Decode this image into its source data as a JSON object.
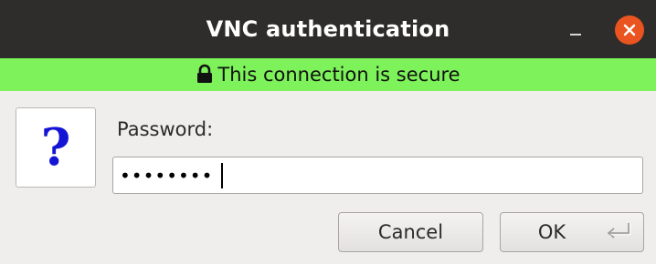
{
  "window": {
    "title": "VNC authentication",
    "controls": {
      "minimize_icon": "minimize-icon",
      "close_icon": "close-icon"
    },
    "colors": {
      "titlebar": "#2e2d2b",
      "close": "#e95420",
      "secure_bar": "#7df25a"
    }
  },
  "security": {
    "text": "This connection is secure",
    "icon": "lock-icon"
  },
  "prompt": {
    "icon": "question-icon",
    "glyph": "?",
    "label": "Password:",
    "masked_value": "••••••••"
  },
  "buttons": {
    "cancel": "Cancel",
    "ok": "OK",
    "ok_icon": "enter-key-icon"
  }
}
